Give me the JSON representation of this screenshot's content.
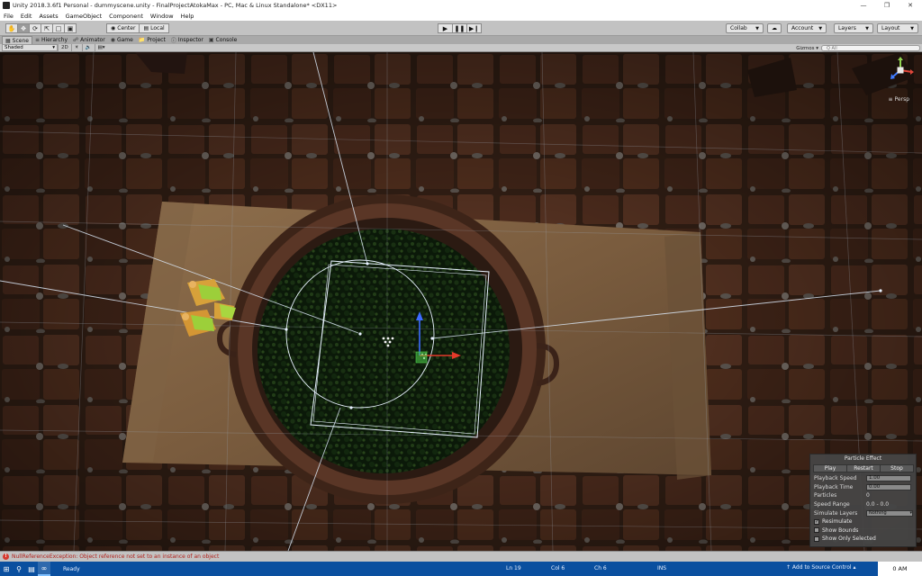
{
  "window": {
    "title": "Unity 2018.3.6f1 Personal - dummyscene.unity - FinalProjectAtokaMax - PC, Mac & Linux Standalone* <DX11>",
    "minimize": "—",
    "maximize": "❐",
    "close": "✕"
  },
  "menu": [
    "File",
    "Edit",
    "Assets",
    "GameObject",
    "Component",
    "Window",
    "Help"
  ],
  "toolbar": {
    "pivot_center": "Center",
    "pivot_local": "Local",
    "collab": "Collab",
    "account": "Account",
    "layers": "Layers",
    "layout": "Layout"
  },
  "tabs": [
    "Scene",
    "Hierarchy",
    "Animator",
    "Game",
    "Project",
    "Inspector",
    "Console"
  ],
  "scene_bar": {
    "shading": "Shaded",
    "mode_2d": "2D",
    "gizmos": "Gizmos",
    "search_placeholder": "Q All"
  },
  "scene_view": {
    "projection": "Persp"
  },
  "particle_panel": {
    "title": "Particle Effect",
    "play": "Play",
    "restart": "Restart",
    "stop": "Stop",
    "playback_speed_label": "Playback Speed",
    "playback_speed_value": "1.00",
    "playback_time_label": "Playback Time",
    "playback_time_value": "0.00",
    "particles_label": "Particles",
    "particles_value": "0",
    "speed_range_label": "Speed Range",
    "speed_range_value": "0.0 - 0.0",
    "simulate_layers_label": "Simulate Layers",
    "simulate_layers_value": "Nothing",
    "resimulate_label": "Resimulate",
    "resimulate_checked": "✓",
    "show_bounds_label": "Show Bounds",
    "show_only_selected_label": "Show Only Selected"
  },
  "console": {
    "message": "NullReferenceException: Object reference not set to an instance of an object"
  },
  "taskbar": {
    "status": "Ready",
    "line": "Ln 19",
    "col": "Col 6",
    "ch": "Ch 6",
    "ins": "INS",
    "source_control": "↑ Add to Source Control ▴",
    "clock": "0 AM"
  },
  "colors": {
    "toolbar_bg": "#c2c2c2",
    "tab_bg": "#a9a9a9",
    "error_red": "#d63a2f",
    "taskbar_blue": "#0a4f9f",
    "gizmo_white": "#e8f2ff"
  }
}
